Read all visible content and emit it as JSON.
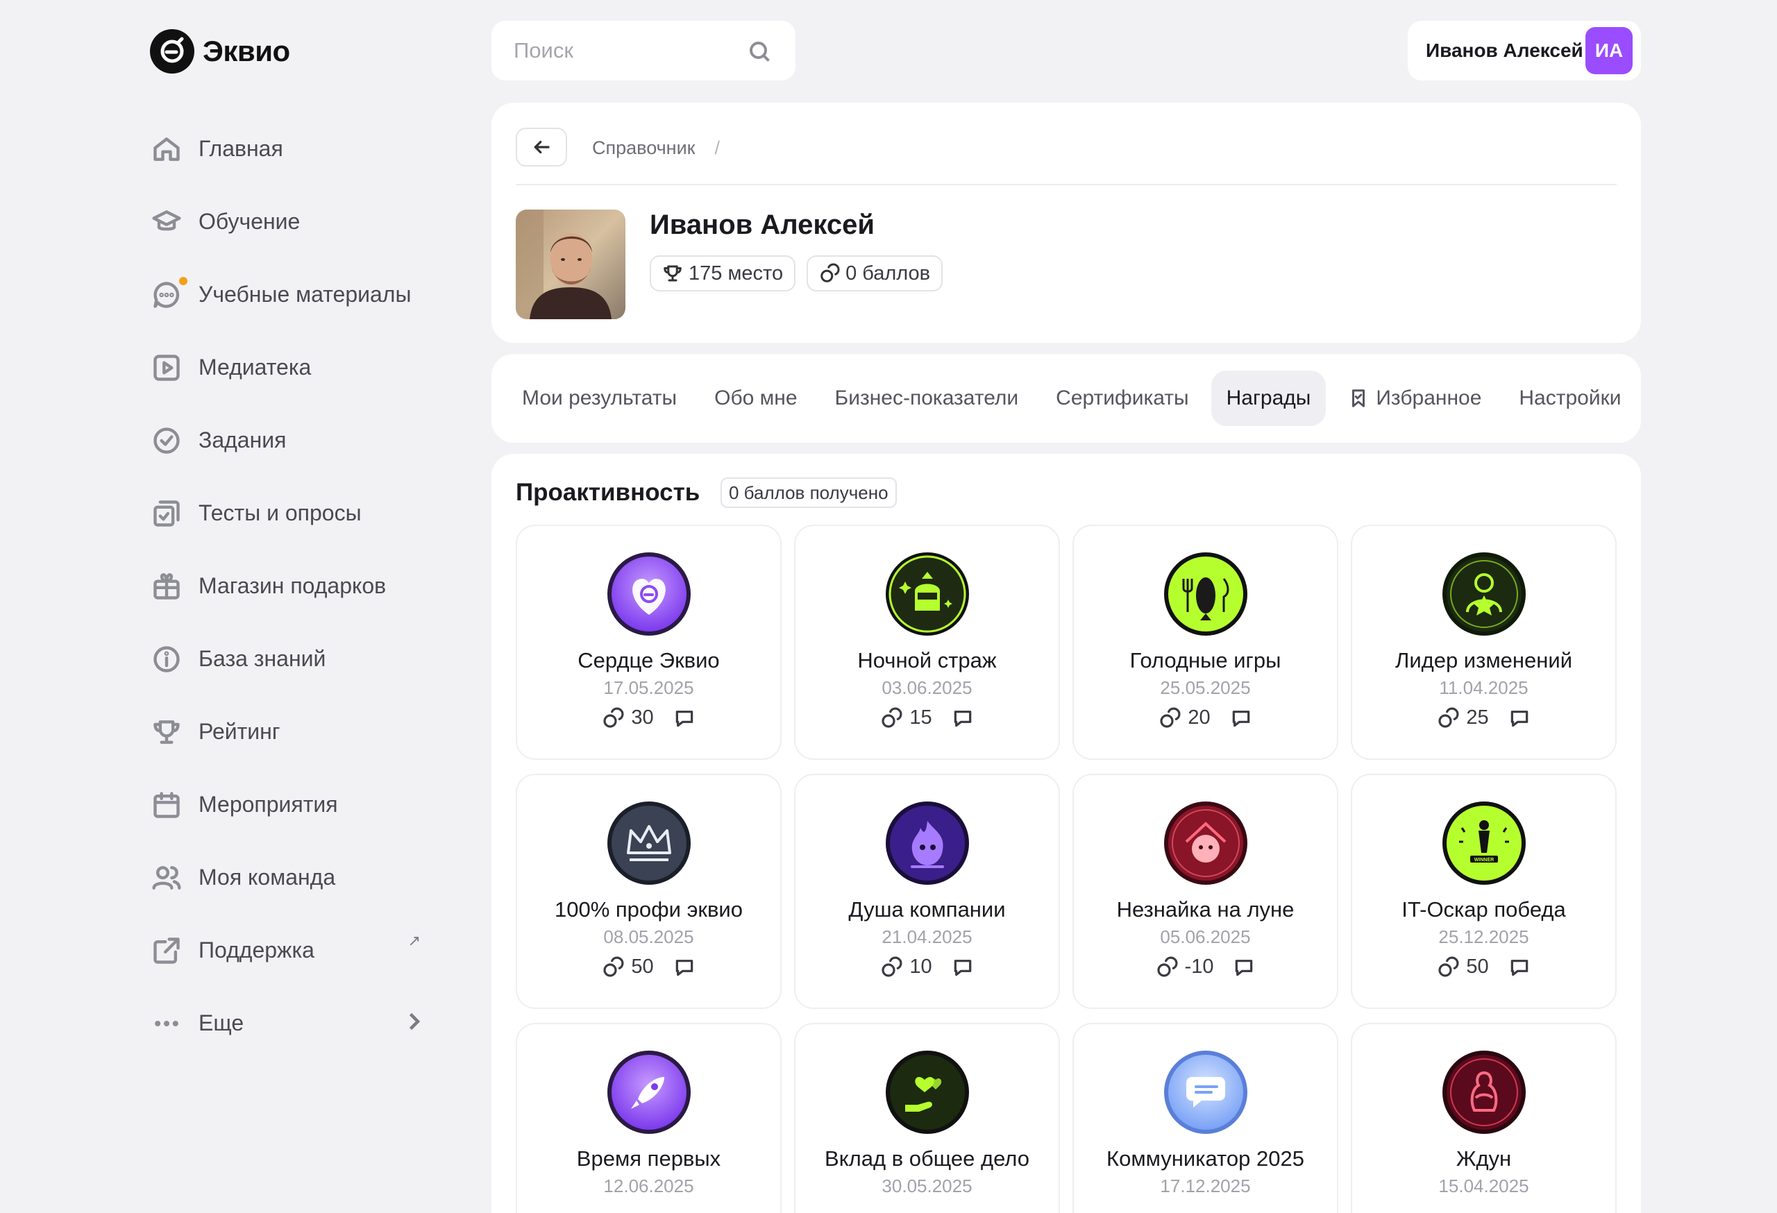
{
  "app": {
    "logo_text": "Эквио"
  },
  "sidebar": {
    "items": [
      {
        "label": "Главная",
        "icon": "home-icon"
      },
      {
        "label": "Обучение",
        "icon": "graduation-cap-icon"
      },
      {
        "label": "Учебные материалы",
        "icon": "chat-icon",
        "has_notification_dot": true
      },
      {
        "label": "Медиатека",
        "icon": "play-icon"
      },
      {
        "label": "Задания",
        "icon": "check-circle-icon"
      },
      {
        "label": "Тесты и опросы",
        "icon": "checklist-icon"
      },
      {
        "label": "Магазин подарков",
        "icon": "gift-icon"
      },
      {
        "label": "База знаний",
        "icon": "info-icon"
      },
      {
        "label": "Рейтинг",
        "icon": "trophy-icon"
      },
      {
        "label": "Мероприятия",
        "icon": "calendar-icon"
      },
      {
        "label": "Моя команда",
        "icon": "users-icon"
      },
      {
        "label": "Поддержка",
        "icon": "external-link-icon",
        "external": true
      },
      {
        "label": "Еще",
        "icon": "more-icon",
        "has_chevron": true
      }
    ]
  },
  "header": {
    "search_placeholder": "Поиск",
    "user_name": "Иванов Алексей",
    "user_initials": "ИА"
  },
  "profile": {
    "breadcrumb": "Справочник",
    "breadcrumb_sep": "/",
    "name": "Иванов Алексей",
    "rank": "175 место",
    "points": "0 баллов"
  },
  "tabs": [
    {
      "label": "Мои результаты",
      "active": false
    },
    {
      "label": "Обо мне",
      "active": false
    },
    {
      "label": "Бизнес-показатели",
      "active": false
    },
    {
      "label": "Сертификаты",
      "active": false
    },
    {
      "label": "Награды",
      "active": true
    },
    {
      "label": "Избранное",
      "active": false,
      "icon": "bookmark-icon"
    },
    {
      "label": "Настройки",
      "active": false
    }
  ],
  "awards_section": {
    "title": "Проактивность",
    "badge": "0 баллов получено",
    "items": [
      {
        "title": "Сердце Эквио",
        "date": "17.05.2025",
        "points": "30",
        "theme": "violet-heart"
      },
      {
        "title": "Ночной страж",
        "date": "03.06.2025",
        "points": "15",
        "theme": "green-knight"
      },
      {
        "title": "Голодные игры",
        "date": "25.05.2025",
        "points": "20",
        "theme": "lime-fish"
      },
      {
        "title": "Лидер изменений",
        "date": "11.04.2025",
        "points": "25",
        "theme": "green-leader"
      },
      {
        "title": "100% профи эквио",
        "date": "08.05.2025",
        "points": "50",
        "theme": "slate-crown"
      },
      {
        "title": "Душа компании",
        "date": "21.04.2025",
        "points": "10",
        "theme": "purple-flame"
      },
      {
        "title": "Незнайка на луне",
        "date": "05.06.2025",
        "points": "-10",
        "theme": "red-moon"
      },
      {
        "title": "IT-Оскар победа",
        "date": "25.12.2025",
        "points": "50",
        "theme": "lime-oscar"
      },
      {
        "title": "Время первых",
        "date": "12.06.2025",
        "points": "",
        "theme": "violet-rocket"
      },
      {
        "title": "Вклад в общее дело",
        "date": "30.05.2025",
        "points": "",
        "theme": "green-hand"
      },
      {
        "title": "Коммуникатор 2025",
        "date": "17.12.2025",
        "points": "",
        "theme": "blue-chat"
      },
      {
        "title": "Ждун",
        "date": "15.04.2025",
        "points": "",
        "theme": "red-zhdun"
      }
    ]
  },
  "colors": {
    "background": "#f2f2f5",
    "accent_avatar": "#9a4dff",
    "notification_dot": "#f2a01a",
    "medal_lime": "#b6ff2e",
    "medal_violet": "#9b5cf6"
  }
}
